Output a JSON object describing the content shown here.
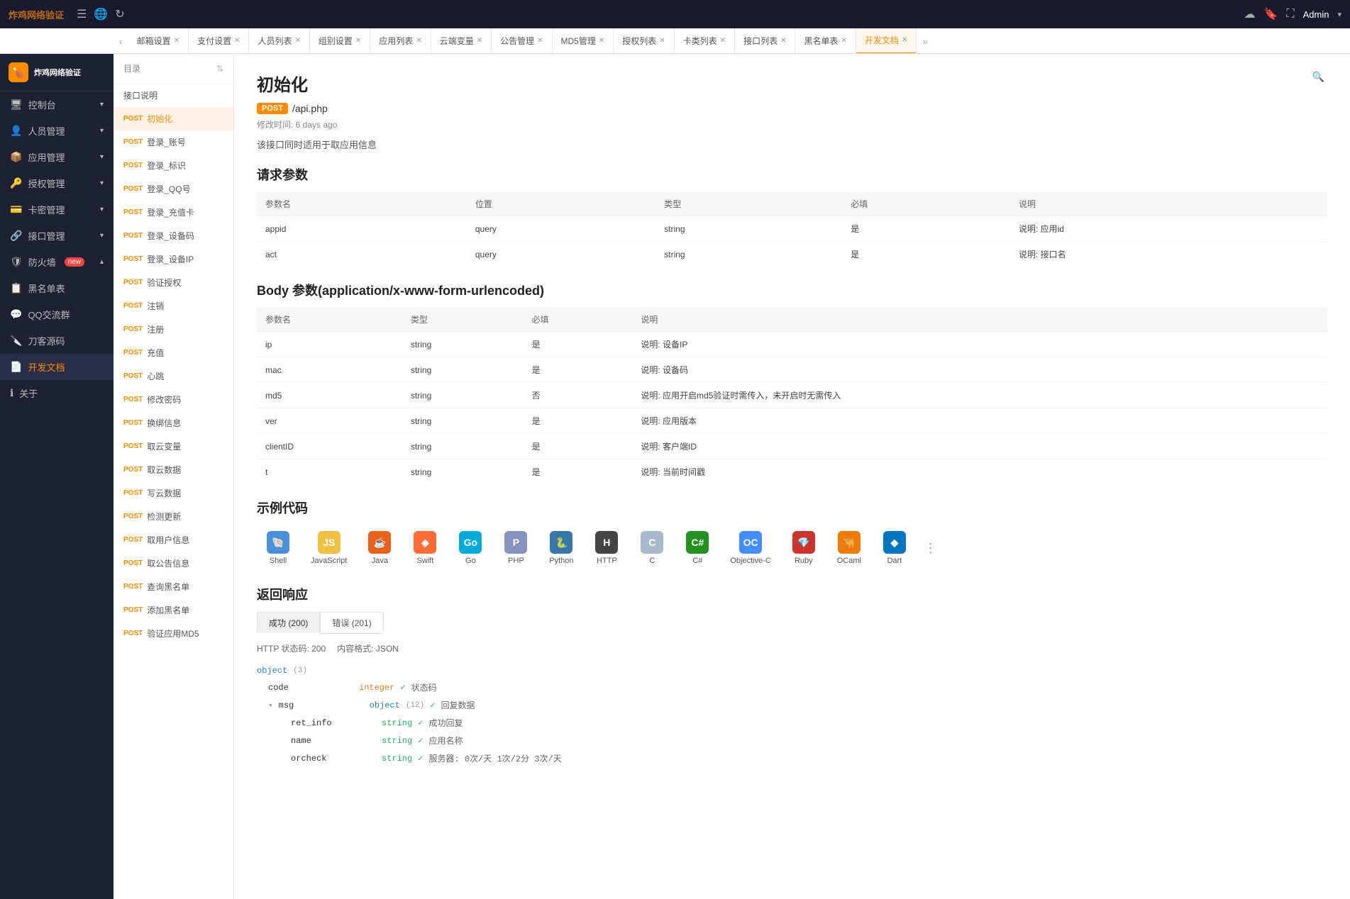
{
  "topbar": {
    "logo": "炸鸡网络验证",
    "admin_label": "Admin",
    "icons": [
      "menu-icon",
      "globe-icon",
      "refresh-icon",
      "cloud-icon",
      "bookmark-icon",
      "expand-icon"
    ]
  },
  "tabs": [
    {
      "label": "邮箱设置",
      "active": false
    },
    {
      "label": "支付设置",
      "active": false
    },
    {
      "label": "人员列表",
      "active": false
    },
    {
      "label": "组别设置",
      "active": false
    },
    {
      "label": "应用列表",
      "active": false
    },
    {
      "label": "云端变量",
      "active": false
    },
    {
      "label": "公告管理",
      "active": false
    },
    {
      "label": "MD5管理",
      "active": false
    },
    {
      "label": "授权列表",
      "active": false
    },
    {
      "label": "卡类列表",
      "active": false
    },
    {
      "label": "接口列表",
      "active": false
    },
    {
      "label": "黑名单表",
      "active": false
    },
    {
      "label": "开发文档",
      "active": true
    }
  ],
  "sidebar": {
    "logo_text": "炸鸡网络验证",
    "items": [
      {
        "label": "控制台",
        "icon": "🖥",
        "has_arrow": true
      },
      {
        "label": "人员管理",
        "icon": "👤",
        "has_arrow": true
      },
      {
        "label": "应用管理",
        "icon": "📦",
        "has_arrow": true
      },
      {
        "label": "授权管理",
        "icon": "🔑",
        "has_arrow": true
      },
      {
        "label": "卡密管理",
        "icon": "💳",
        "has_arrow": true
      },
      {
        "label": "接口管理",
        "icon": "🔗",
        "has_arrow": true
      },
      {
        "label": "防火墙",
        "icon": "🛡",
        "has_arrow": true,
        "badge": "new"
      },
      {
        "label": "黑名单表",
        "icon": "📋"
      },
      {
        "label": "QQ交流群",
        "icon": "💬"
      },
      {
        "label": "刀客源码",
        "icon": "🔪"
      },
      {
        "label": "开发文档",
        "icon": "📄"
      },
      {
        "label": "关于",
        "icon": "ℹ"
      }
    ]
  },
  "left_nav": {
    "header": "目录",
    "items": [
      {
        "label": "接口说明"
      },
      {
        "label": "初始化",
        "post": true,
        "active": true
      },
      {
        "label": "登录_账号",
        "post": true
      },
      {
        "label": "登录_标识",
        "post": true
      },
      {
        "label": "登录_QQ号",
        "post": true
      },
      {
        "label": "登录_充值卡",
        "post": true
      },
      {
        "label": "登录_设备码",
        "post": true
      },
      {
        "label": "登录_设备IP",
        "post": true
      },
      {
        "label": "验证授权",
        "post": true
      },
      {
        "label": "注销",
        "post": true
      },
      {
        "label": "注册",
        "post": true
      },
      {
        "label": "充值",
        "post": true
      },
      {
        "label": "心跳",
        "post": true
      },
      {
        "label": "修改密码",
        "post": true
      },
      {
        "label": "换绑信息",
        "post": true
      },
      {
        "label": "取云变量",
        "post": true
      },
      {
        "label": "取云数据",
        "post": true
      },
      {
        "label": "写云数据",
        "post": true
      },
      {
        "label": "检测更新",
        "post": true
      },
      {
        "label": "取用户信息",
        "post": true
      },
      {
        "label": "取公告信息",
        "post": true
      },
      {
        "label": "查询黑名单",
        "post": true
      },
      {
        "label": "添加黑名单",
        "post": true
      },
      {
        "label": "验证应用MD5",
        "post": true
      }
    ]
  },
  "page": {
    "title": "初始化",
    "method": "POST",
    "path": "/api.php",
    "modified": "修改时间: 6 days ago",
    "description": "该接口同时适用于取应用信息"
  },
  "request_params": {
    "title": "请求参数",
    "columns": [
      "参数名",
      "位置",
      "类型",
      "必填",
      "说明"
    ],
    "rows": [
      {
        "name": "appid",
        "position": "query",
        "type": "string",
        "required": "是",
        "desc": "说明: 应用id"
      },
      {
        "name": "act",
        "position": "query",
        "type": "string",
        "required": "是",
        "desc": "说明: 接口名"
      }
    ]
  },
  "body_params": {
    "title": "Body 参数(application/x-www-form-urlencoded)",
    "columns": [
      "参数名",
      "类型",
      "必填",
      "说明"
    ],
    "rows": [
      {
        "name": "ip",
        "type": "string",
        "required": "是",
        "desc": "说明: 设备IP"
      },
      {
        "name": "mac",
        "type": "string",
        "required": "是",
        "desc": "说明: 设备码"
      },
      {
        "name": "md5",
        "type": "string",
        "required": "否",
        "desc": "说明: 应用开启md5验证时需传入，未开启时无需传入"
      },
      {
        "name": "ver",
        "type": "string",
        "required": "是",
        "desc": "说明: 应用版本"
      },
      {
        "name": "clientID",
        "type": "string",
        "required": "是",
        "desc": "说明: 客户端ID"
      },
      {
        "name": "t",
        "type": "string",
        "required": "是",
        "desc": "说明: 当前时间戳"
      }
    ]
  },
  "code_examples": {
    "title": "示例代码",
    "langs": [
      {
        "name": "Shell",
        "color": "#4a90d9",
        "icon": "🐚"
      },
      {
        "name": "JavaScript",
        "color": "#f7df1e",
        "icon": "JS"
      },
      {
        "name": "Java",
        "color": "#e8611a",
        "icon": "☕"
      },
      {
        "name": "Swift",
        "color": "#ff6b35",
        "icon": "◈"
      },
      {
        "name": "Go",
        "color": "#00acd7",
        "icon": "Go"
      },
      {
        "name": "PHP",
        "color": "#8993be",
        "icon": "PHP"
      },
      {
        "name": "Python",
        "color": "#3776ab",
        "icon": "🐍"
      },
      {
        "name": "HTTP",
        "color": "#333",
        "icon": "H"
      },
      {
        "name": "C",
        "color": "#a8b9cc",
        "icon": "C"
      },
      {
        "name": "C#",
        "color": "#239120",
        "icon": "C#"
      },
      {
        "name": "Objective-C",
        "color": "#438eff",
        "icon": "OC"
      },
      {
        "name": "Ruby",
        "color": "#cc342d",
        "icon": "💎"
      },
      {
        "name": "OCaml",
        "color": "#ef7a08",
        "icon": "🐫"
      },
      {
        "name": "Dart",
        "color": "#0175c2",
        "icon": "◆"
      }
    ]
  },
  "response": {
    "title": "返回响应",
    "tabs": [
      {
        "label": "成功 (200)",
        "active": true
      },
      {
        "label": "错误 (201)",
        "active": false
      }
    ],
    "http_status": "HTTP 状态码: 200",
    "content_format": "内容格式: JSON",
    "object": {
      "type": "object",
      "count": 3,
      "fields": [
        {
          "key": "code",
          "type": "integer",
          "required": true,
          "desc": "状态码"
        },
        {
          "key": "msg",
          "type": "object",
          "count": 12,
          "required": true,
          "desc": "回复数据",
          "children": [
            {
              "key": "ret_info",
              "type": "string",
              "required": true,
              "desc": "成功回复"
            },
            {
              "key": "name",
              "type": "string",
              "required": true,
              "desc": "应用名称"
            },
            {
              "key": "orcheck",
              "type": "string",
              "required": true,
              "desc": "服务器: 0次/天 1次/2分 3次/天"
            }
          ]
        }
      ]
    }
  }
}
